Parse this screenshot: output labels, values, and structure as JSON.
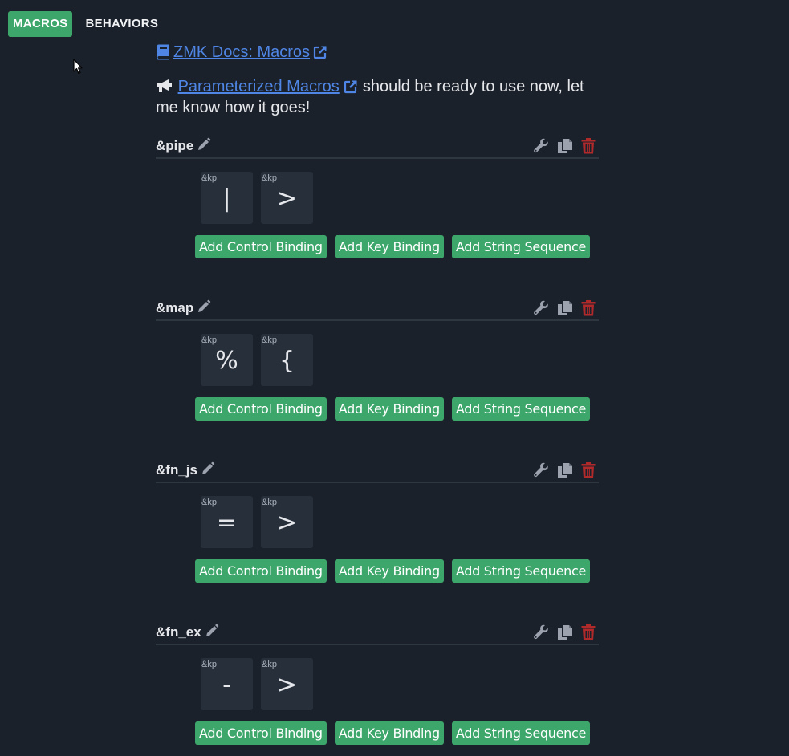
{
  "tabs": [
    {
      "label": "MACROS",
      "active": true
    },
    {
      "label": "BEHAVIORS",
      "active": false
    }
  ],
  "docs_link": {
    "label": "ZMK Docs: Macros"
  },
  "announcement": {
    "link_label": "Parameterized Macros",
    "text": " should be ready to use now, let me know how it goes!"
  },
  "colors": {
    "background": "#1b212b",
    "accent_green": "#3da66b",
    "link_blue": "#4f86e6",
    "delete_red": "#c0392b",
    "key_bg": "#262f3a"
  },
  "buttons": {
    "add_control": "Add Control Binding",
    "add_key": "Add Key Binding",
    "add_string": "Add String Sequence"
  },
  "macros": [
    {
      "name": "&pipe",
      "bindings": [
        {
          "behavior": "&kp",
          "label": "|"
        },
        {
          "behavior": "&kp",
          "label": ">"
        }
      ]
    },
    {
      "name": "&map",
      "bindings": [
        {
          "behavior": "&kp",
          "label": "%"
        },
        {
          "behavior": "&kp",
          "label": "{"
        }
      ]
    },
    {
      "name": "&fn_js",
      "bindings": [
        {
          "behavior": "&kp",
          "label": "="
        },
        {
          "behavior": "&kp",
          "label": ">"
        }
      ]
    },
    {
      "name": "&fn_ex",
      "bindings": [
        {
          "behavior": "&kp",
          "label": "-"
        },
        {
          "behavior": "&kp",
          "label": ">"
        }
      ]
    }
  ]
}
